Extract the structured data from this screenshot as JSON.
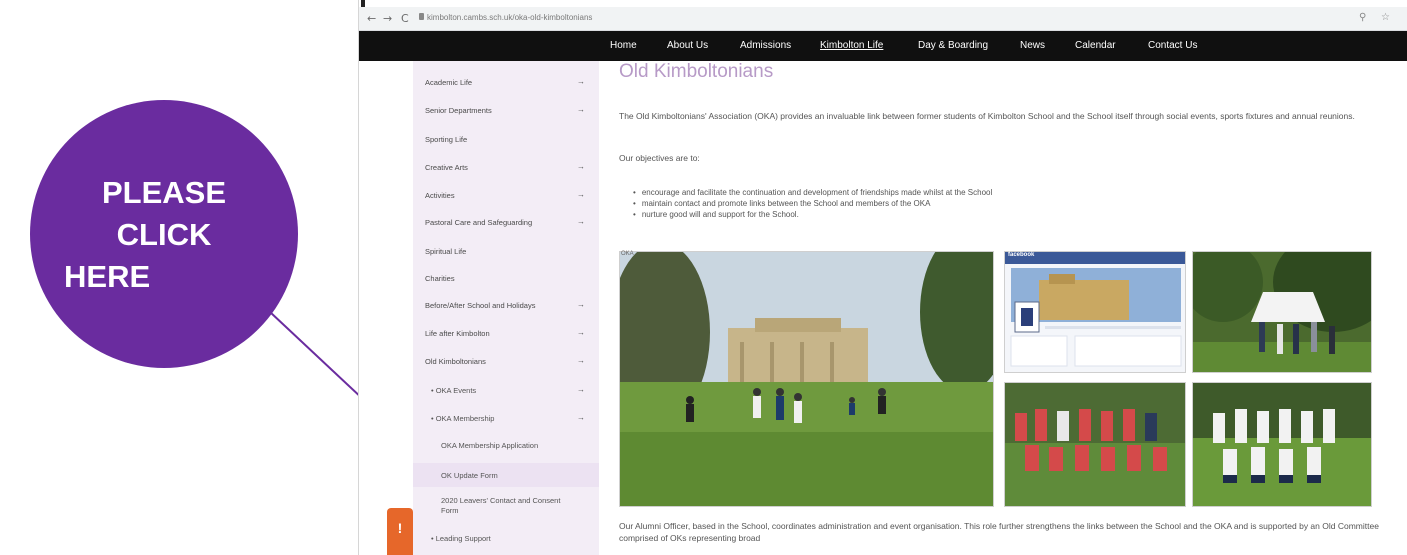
{
  "callout": {
    "line1": "PLEASE",
    "line2": "CLICK",
    "line3": "HERE",
    "color": "#6a2c9f",
    "arrow_color": "#6a2c9f"
  },
  "browser": {
    "url": "kimbolton.cambs.sch.uk/oka-old-kimboltonians",
    "nav_back": "←",
    "nav_forward": "→",
    "nav_reload": "C"
  },
  "navbar": {
    "items": [
      "Home",
      "About Us",
      "Admissions",
      "Kimbolton Life",
      "Day & Boarding",
      "News",
      "Calendar",
      "Contact Us"
    ],
    "active": "Kimbolton Life"
  },
  "sidebar": {
    "items": [
      {
        "label": "Academic Life",
        "chevron": "→"
      },
      {
        "label": "Senior Departments",
        "chevron": "→"
      },
      {
        "label": "Sporting Life",
        "chevron": ""
      },
      {
        "label": "Creative Arts",
        "chevron": "→"
      },
      {
        "label": "Activities",
        "chevron": "→"
      },
      {
        "label": "Pastoral Care and Safeguarding",
        "chevron": "→"
      },
      {
        "label": "Spiritual Life",
        "chevron": ""
      },
      {
        "label": "Charities",
        "chevron": ""
      },
      {
        "label": "Before/After School and Holidays",
        "chevron": "→"
      },
      {
        "label": "Life after Kimbolton",
        "chevron": "→"
      },
      {
        "label": "Old Kimboltonians",
        "chevron": "→"
      },
      {
        "label": "• OKA Events",
        "chevron": "→"
      },
      {
        "label": "• OKA Membership",
        "chevron": "→"
      },
      {
        "label": "OKA Membership Application",
        "chevron": ""
      },
      {
        "label": "OK Update Form",
        "chevron": ""
      },
      {
        "label": "2020 Leavers' Contact and Consent Form",
        "chevron": ""
      },
      {
        "label": "• Leading Support",
        "chevron": ""
      }
    ],
    "alert_icon": "!"
  },
  "content": {
    "title": "Old Kimboltonians",
    "intro": "The Old Kimboltonians' Association (OKA) provides an invaluable link between former students of Kimbolton School and the School itself through social events, sports fixtures and annual reunions.",
    "objectives_lead": "Our objectives are to:",
    "objectives": [
      "encourage and facilitate the continuation and development of friendships made whilst at the School",
      "maintain contact and promote links between the School and members of the OKA",
      "nurture good will and support for the School."
    ],
    "facebook_label": "facebook",
    "photo_caption": "OKA",
    "footer": "Our Alumni Officer, based in the School, coordinates administration and event organisation. This role further strengthens the links between the School and the OKA and is supported by an Old Committee comprised of OKs representing broad"
  },
  "colors": {
    "navbar_bg": "#101010",
    "sidebar_bg": "#f3edf6",
    "title_color": "#b79ac7",
    "alert_bg": "#e6672a"
  }
}
